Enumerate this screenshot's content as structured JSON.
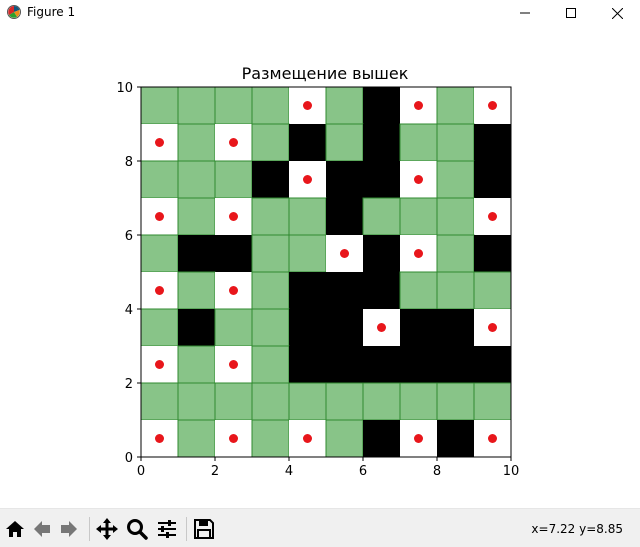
{
  "window": {
    "title": "Figure 1",
    "icon": "matplotlib-icon",
    "controls": [
      "minimize-icon",
      "maximize-icon",
      "close-icon"
    ]
  },
  "toolbar": {
    "buttons": [
      "home-icon",
      "back-icon",
      "forward-icon",
      "pan-icon",
      "zoom-icon",
      "configure-subplots-icon",
      "save-icon"
    ],
    "coords": "x=7.22 y=8.85"
  },
  "colors": {
    "green": "#88c488",
    "green_edge": "#2f8a2f",
    "black": "#000000",
    "white": "#ffffff",
    "dot": "#e8161b"
  },
  "chart_data": {
    "type": "heatmap",
    "title": "Размещение вышек",
    "xlabel": "",
    "ylabel": "",
    "xlim": [
      0,
      10
    ],
    "ylim": [
      0,
      10
    ],
    "xticks": [
      0,
      2,
      4,
      6,
      8,
      10
    ],
    "yticks": [
      0,
      2,
      4,
      6,
      8,
      10
    ],
    "legend": {
      "G": "green cell",
      "B": "black cell",
      "W": "white cell with red dot"
    },
    "grid_rows_top_to_bottom": [
      [
        "G",
        "G",
        "G",
        "G",
        "W",
        "G",
        "B",
        "W",
        "G",
        "W"
      ],
      [
        "W",
        "G",
        "W",
        "G",
        "B",
        "G",
        "B",
        "G",
        "G",
        "B"
      ],
      [
        "G",
        "G",
        "G",
        "B",
        "W",
        "B",
        "B",
        "W",
        "G",
        "B"
      ],
      [
        "W",
        "G",
        "W",
        "G",
        "G",
        "B",
        "G",
        "G",
        "G",
        "W"
      ],
      [
        "G",
        "B",
        "B",
        "G",
        "G",
        "W",
        "B",
        "W",
        "G",
        "B"
      ],
      [
        "W",
        "G",
        "W",
        "G",
        "B",
        "B",
        "B",
        "G",
        "G",
        "G"
      ],
      [
        "G",
        "B",
        "G",
        "G",
        "B",
        "B",
        "W",
        "B",
        "B",
        "W"
      ],
      [
        "W",
        "G",
        "W",
        "G",
        "B",
        "B",
        "B",
        "B",
        "B",
        "B"
      ],
      [
        "G",
        "G",
        "G",
        "G",
        "G",
        "G",
        "G",
        "G",
        "G",
        "G"
      ],
      [
        "W",
        "G",
        "W",
        "G",
        "W",
        "G",
        "B",
        "W",
        "B",
        "W"
      ]
    ],
    "markers": {
      "type": "scatter",
      "color": "#e8161b",
      "points": [
        [
          4.5,
          9.5
        ],
        [
          7.5,
          9.5
        ],
        [
          9.5,
          9.5
        ],
        [
          0.5,
          8.5
        ],
        [
          2.5,
          8.5
        ],
        [
          4.5,
          7.5
        ],
        [
          7.5,
          7.5
        ],
        [
          0.5,
          6.5
        ],
        [
          2.5,
          6.5
        ],
        [
          9.5,
          6.5
        ],
        [
          5.5,
          5.5
        ],
        [
          7.5,
          5.5
        ],
        [
          0.5,
          4.5
        ],
        [
          2.5,
          4.5
        ],
        [
          6.5,
          3.5
        ],
        [
          9.5,
          3.5
        ],
        [
          0.5,
          2.5
        ],
        [
          2.5,
          2.5
        ],
        [
          0.5,
          0.5
        ],
        [
          2.5,
          0.5
        ],
        [
          4.5,
          0.5
        ],
        [
          7.5,
          0.5
        ],
        [
          9.5,
          0.5
        ]
      ]
    }
  }
}
